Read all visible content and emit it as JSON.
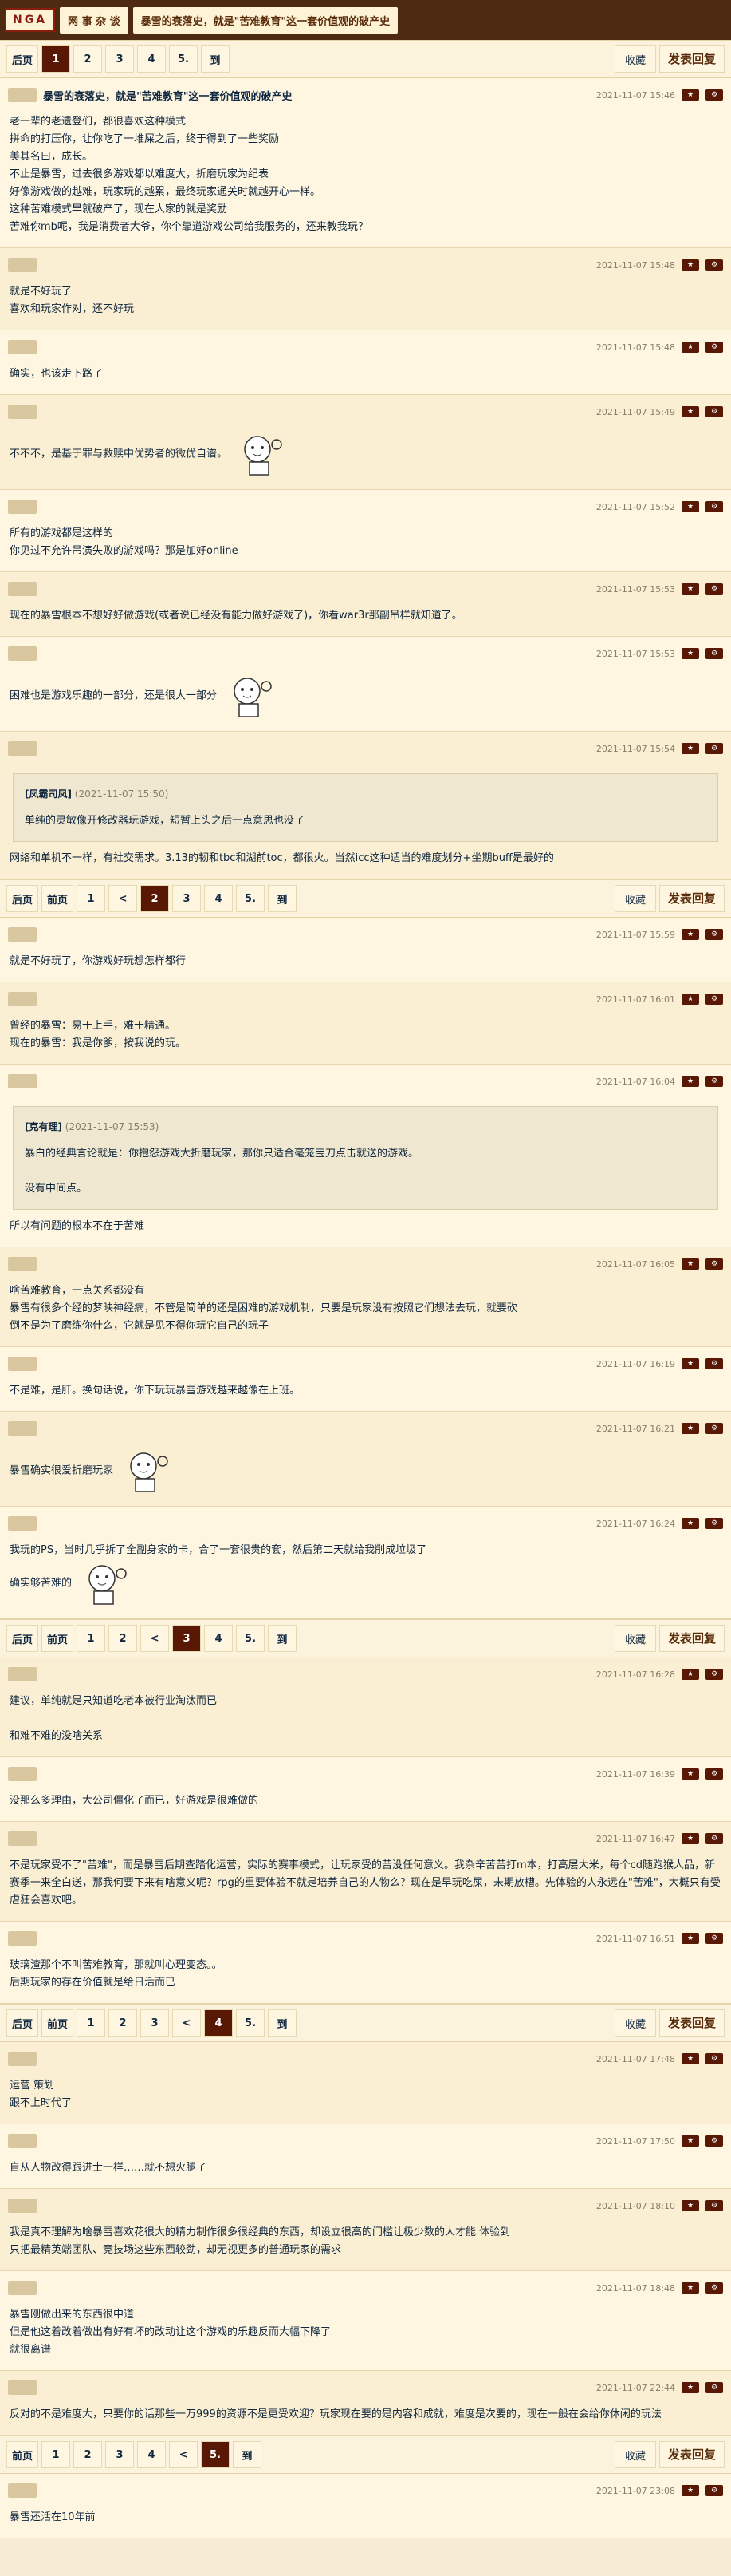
{
  "nav": {
    "logo": "NGA",
    "board": "网 事 杂 谈",
    "thread_title": "暴雪的衰落史，就是\"苦难教育\"这一套价值观的破产史"
  },
  "pagers": [
    {
      "pages": [
        "后页",
        "1",
        "2",
        "3",
        "4",
        "5.",
        "到"
      ],
      "current": "1"
    },
    {
      "pages": [
        "后页",
        "前页",
        "1",
        "<",
        "2",
        "3",
        "4",
        "5.",
        "到"
      ],
      "current": "2"
    },
    {
      "pages": [
        "后页",
        "前页",
        "1",
        "2",
        "<",
        "3",
        "4",
        "5.",
        "到"
      ],
      "current": "3"
    },
    {
      "pages": [
        "后页",
        "前页",
        "1",
        "2",
        "3",
        "<",
        "4",
        "5.",
        "到"
      ],
      "current": "4"
    },
    {
      "pages": [
        "前页",
        "1",
        "2",
        "3",
        "4",
        "<",
        "5.",
        "到"
      ],
      "current": "5."
    }
  ],
  "pager_right": {
    "fav": "收藏",
    "reply": "发表回复"
  },
  "posts": [
    {
      "title": "暴雪的衰落史，就是\"苦难教育\"这一套价值观的破产史",
      "time": "2021-11-07 15:46",
      "lines": [
        "老一辈的老遗登们，都很喜欢这种模式",
        "拼命的打压你，让你吃了一堆屎之后，终于得到了一些奖励",
        "美其名曰，成长。",
        "不止是暴雪，过去很多游戏都以难度大，折磨玩家为纪表",
        "好像游戏做的越难，玩家玩的越累，最终玩家通关时就越开心一样。",
        "这种苦难模式早就破产了，现在人家的就是奖励",
        "苦难你mb呢，我是消费者大爷，你个靠道游戏公司给我服务的，还来教我玩？"
      ]
    },
    {
      "time": "2021-11-07 15:48",
      "lines": [
        "就是不好玩了",
        "喜欢和玩家作对，还不好玩"
      ]
    },
    {
      "time": "2021-11-07 15:48",
      "lines": [
        "确实，也该走下路了"
      ]
    },
    {
      "time": "2021-11-07 15:49",
      "lines": [
        "不不不，是基于罪与救赎中优势者的微优自谱。"
      ],
      "sticker": true
    },
    {
      "time": "2021-11-07 15:52",
      "lines": [
        "所有的游戏都是这样的",
        "你见过不允许吊演失败的游戏吗？那是加好online"
      ]
    },
    {
      "time": "2021-11-07 15:53",
      "lines": [
        "现在的暴雪根本不想好好做游戏(或者说已经没有能力做好游戏了)，你看war3r那副吊样就知道了。"
      ]
    },
    {
      "time": "2021-11-07 15:53",
      "lines": [
        "困难也是游戏乐趣的一部分，还是很大一部分"
      ],
      "sticker": true
    },
    {
      "time": "2021-11-07 15:54",
      "quote": {
        "user": "[凤霸司凤]",
        "time": "(2021-11-07 15:50)",
        "text": "单纯的灵敏像开修改器玩游戏，短暂上头之后一点意思也没了"
      },
      "lines": [
        "网络和单机不一样，有社交需求。3.13的韧和tbc和湖前toc，都很火。当然icc这种适当的难度划分+坐期buff是最好的"
      ]
    },
    {
      "time": "2021-11-07 15:59",
      "lines": [
        "就是不好玩了，你游戏好玩想怎样都行"
      ]
    },
    {
      "time": "2021-11-07 16:01",
      "lines": [
        "曾经的暴雪：易于上手，难于精通。",
        "现在的暴雪：我是你爹，按我说的玩。"
      ]
    },
    {
      "time": "2021-11-07 16:04",
      "quote": {
        "user": "[克有理]",
        "time": "(2021-11-07 15:53)",
        "text": "暴白的经典言论就是：你抱怨游戏大折磨玩家，那你只适合毫笼宝刀点击就送的游戏。",
        "text2": "没有中间点。"
      },
      "lines": [
        "所以有问题的根本不在于苦难"
      ]
    },
    {
      "time": "2021-11-07 16:05",
      "lines": [
        "啥苦难教育，一点关系都没有",
        "暴雪有很多个经的梦映神经病，不管是简单的还是困难的游戏机制，只要是玩家没有按照它们想法去玩，就要砍",
        "倒不是为了磨练你什么，它就是见不得你玩它自己的玩子"
      ]
    },
    {
      "time": "2021-11-07 16:19",
      "lines": [
        "不是难，是肝。换句话说，你下玩玩暴雪游戏越来越像在上班。"
      ]
    },
    {
      "time": "2021-11-07 16:21",
      "lines": [
        "暴雪确实很爱折磨玩家"
      ],
      "sticker": true
    },
    {
      "time": "2021-11-07 16:24",
      "lines": [
        "我玩的PS，当时几乎拆了全副身家的卡，合了一套很贵的套，然后第二天就给我削成垃圾了",
        "确实够苦难的"
      ],
      "sticker": true
    },
    {
      "time": "2021-11-07 16:28",
      "lines": [
        "建议，单纯就是只知道吃老本被行业淘汰而已",
        "",
        "和难不难的没啥关系"
      ]
    },
    {
      "time": "2021-11-07 16:39",
      "lines": [
        "没那么多理由，大公司僵化了而已，好游戏是很难做的"
      ]
    },
    {
      "time": "2021-11-07 16:47",
      "lines": [
        "不是玩家受不了\"苦难\"，而是暴雪后期查踏化运营，实际的赛事模式，让玩家受的苦没任何意义。我杂辛苦苦打m本，打高层大米，每个cd随跑猴人品，新赛季一来全白送，那我何要下来有啥意义呢？rpg的重要体验不就是培养自己的人物么？现在是早玩吃屎，未期放槽。先体验的人永远在\"苦难\"，大概只有受虐狂会喜欢吧。"
      ]
    },
    {
      "time": "2021-11-07 16:51",
      "lines": [
        "玻璃渣那个不叫苦难教育，那就叫心理变态。。",
        "后期玩家的存在价值就是给日活而已"
      ]
    },
    {
      "time": "2021-11-07 17:48",
      "lines": [
        "运营 策划",
        "跟不上时代了"
      ]
    },
    {
      "time": "2021-11-07 17:50",
      "lines": [
        "自从人物改得跟进士一样……就不想火腿了"
      ]
    },
    {
      "time": "2021-11-07 18:10",
      "lines": [
        "我是真不理解为啥暴雪喜欢花很大的精力制作很多很经典的东西，却设立很高的门槛让极少数的人才能 体验到",
        "只把最精英端团队、竞技场这些东西较劲，却无视更多的普通玩家的需求"
      ]
    },
    {
      "time": "2021-11-07 18:48",
      "lines": [
        "暴雪刚做出来的东西很中道",
        "但是他这着改着做出有好有坏的改动让这个游戏的乐趣反而大幅下降了",
        "就很离谱"
      ]
    },
    {
      "time": "2021-11-07 22:44",
      "lines": [
        "反对的不是难度大，只要你的话那些一万999的资源不是更受欢迎？玩家现在要的是内容和成就，难度是次要的，现在一般在会给你休闲的玩法"
      ]
    },
    {
      "time": "2021-11-07 23:08",
      "lines": [
        "暴雪还活在10年前"
      ]
    }
  ]
}
